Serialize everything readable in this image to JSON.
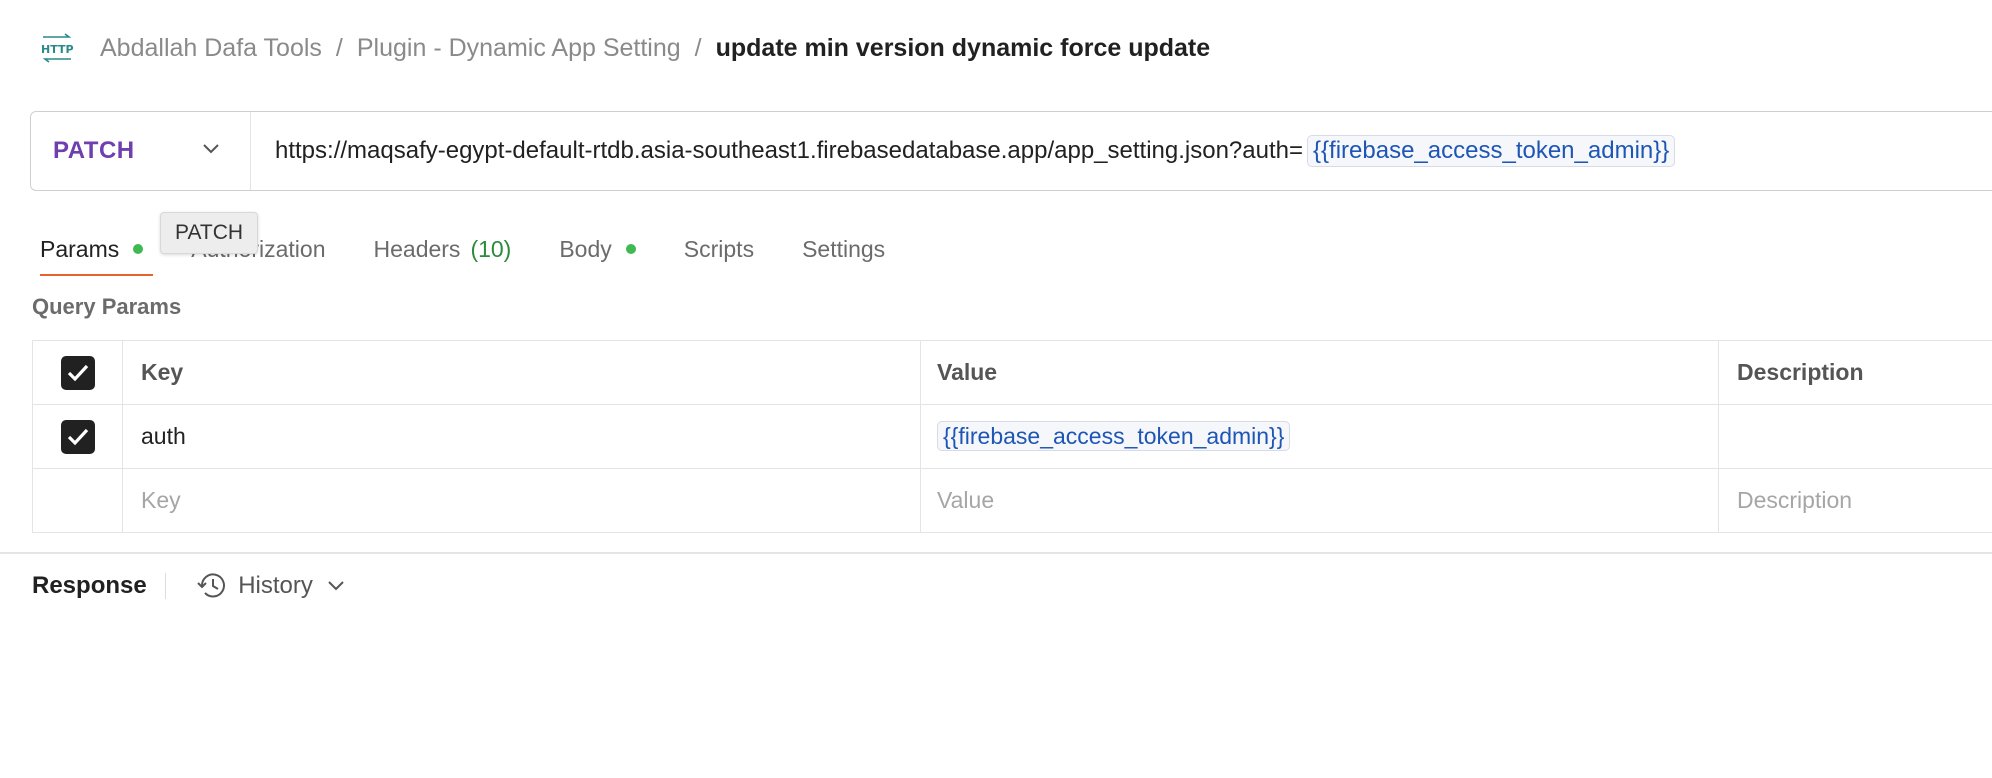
{
  "breadcrumb": {
    "icon": "http-icon",
    "items": [
      "Abdallah Dafa Tools",
      "Plugin - Dynamic App Setting"
    ],
    "separator": "/",
    "current": "update min version dynamic force update"
  },
  "request": {
    "method": "PATCH",
    "url_prefix": "https://maqsafy-egypt-default-rtdb.asia-southeast1.firebasedatabase.app/app_setting.json?auth=",
    "url_variable": "{{firebase_access_token_admin}}"
  },
  "tabs": {
    "params": "Params",
    "authorization": "Authorization",
    "headers": "Headers",
    "headers_count": "(10)",
    "body": "Body",
    "scripts": "Scripts",
    "settings": "Settings"
  },
  "tooltip": "PATCH",
  "query_params": {
    "title": "Query Params",
    "columns": {
      "key": "Key",
      "value": "Value",
      "description": "Description"
    },
    "rows": [
      {
        "checked": true,
        "key": "auth",
        "value": "{{firebase_access_token_admin}}",
        "description": ""
      }
    ],
    "placeholders": {
      "key": "Key",
      "value": "Value",
      "description": "Description"
    }
  },
  "response": {
    "label": "Response",
    "history": "History"
  },
  "colors": {
    "method": "#6f3fb0",
    "variable": "#1e56b5",
    "active_tab_underline": "#e8602c",
    "status_dot": "#3fb950",
    "count": "#2e8b3e"
  }
}
